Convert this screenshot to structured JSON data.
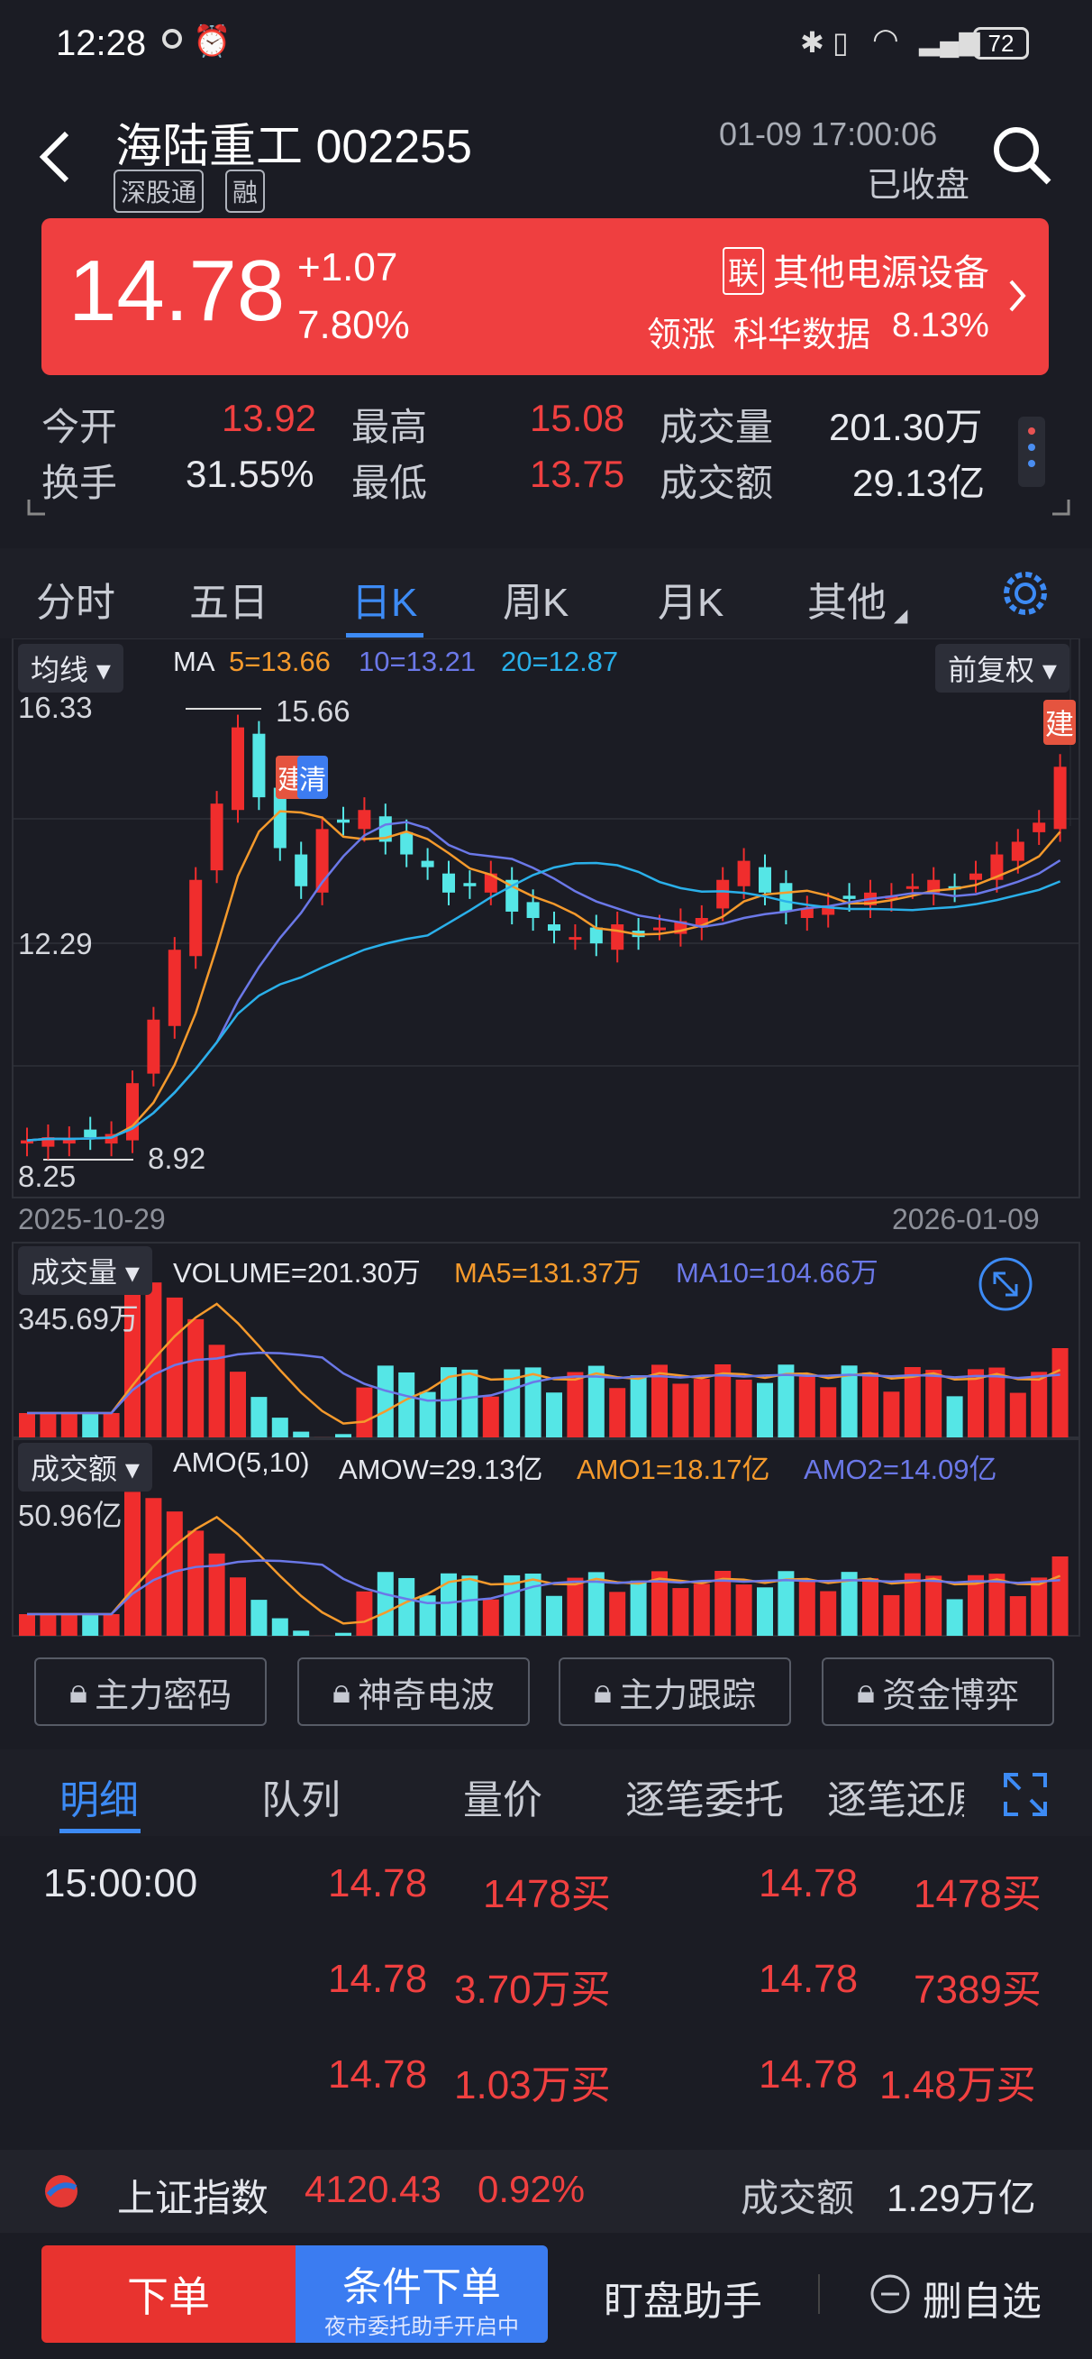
{
  "status": {
    "time": "12:28",
    "battery": "72"
  },
  "header": {
    "name": "海陆重工 002255",
    "tags": [
      "深股通",
      "融"
    ],
    "datetime": "01-09 17:00:06",
    "market_status": "已收盘"
  },
  "quote": {
    "price": "14.78",
    "change": "+1.07",
    "pct": "7.80%",
    "sector_badge": "联",
    "sector": "其他电源设备",
    "leader_label": "领涨",
    "leader_name": "科华数据",
    "leader_pct": "8.13%"
  },
  "stats": {
    "open_label": "今开",
    "open": "13.92",
    "high_label": "最高",
    "high": "15.08",
    "vol_label": "成交量",
    "vol": "201.30万",
    "turn_label": "换手",
    "turn": "31.55%",
    "low_label": "最低",
    "low": "13.75",
    "amt_label": "成交额",
    "amt": "29.13亿"
  },
  "tabs": [
    "分时",
    "五日",
    "日K",
    "周K",
    "月K",
    "其他"
  ],
  "active_tab": "日K",
  "kline": {
    "indicator_dropdown": "均线",
    "adjust_dropdown": "前复权",
    "ma_label": "MA",
    "ma5": "5=13.66",
    "ma10": "10=13.21",
    "ma20": "20=12.87",
    "y_top": "16.33",
    "y_mid": "12.29",
    "y_bottom": "8.25",
    "high_mark": "15.66",
    "low_mark": "8.92",
    "date_start": "2025-10-29",
    "date_end": "2026-01-09",
    "badge_jian": "建",
    "badge_qing": "清",
    "colors": {
      "up": "#f02d2d",
      "down": "#55e6e6",
      "ma5": "#f59a2c",
      "ma10": "#6b78e8",
      "ma20": "#2ab0ea"
    }
  },
  "volume": {
    "dropdown": "成交量",
    "label": "VOLUME=201.30万",
    "ma5": "MA5=131.37万",
    "ma10": "MA10=104.66万",
    "max": "345.69万"
  },
  "amount": {
    "dropdown": "成交额",
    "label": "AMO(5,10)",
    "amow": "AMOW=29.13亿",
    "amo1": "AMO1=18.17亿",
    "amo2": "AMO2=14.09亿",
    "max": "50.96亿"
  },
  "lock_buttons": [
    "主力密码",
    "神奇电波",
    "主力跟踪",
    "资金博弈"
  ],
  "detail_tabs": [
    "明细",
    "队列",
    "量价",
    "逐笔委托",
    "逐笔还原"
  ],
  "detail_rows": [
    {
      "time": "15:00:00",
      "p1": "14.78",
      "v1": "1478买",
      "p2": "14.78",
      "v2": "1478买"
    },
    {
      "time": "",
      "p1": "14.78",
      "v1": "3.70万买",
      "p2": "14.78",
      "v2": "7389买"
    },
    {
      "time": "",
      "p1": "14.78",
      "v1": "1.03万买",
      "p2": "14.78",
      "v2": "1.48万买"
    }
  ],
  "index_bar": {
    "name": "上证指数",
    "value": "4120.43",
    "pct": "0.92%",
    "amt_label": "成交额",
    "amt": "1.29万亿"
  },
  "bottom": {
    "order": "下单",
    "cond_order": "条件下单",
    "cond_sub": "夜市委托助手开启中",
    "assistant": "盯盘助手",
    "remove": "删自选"
  }
}
